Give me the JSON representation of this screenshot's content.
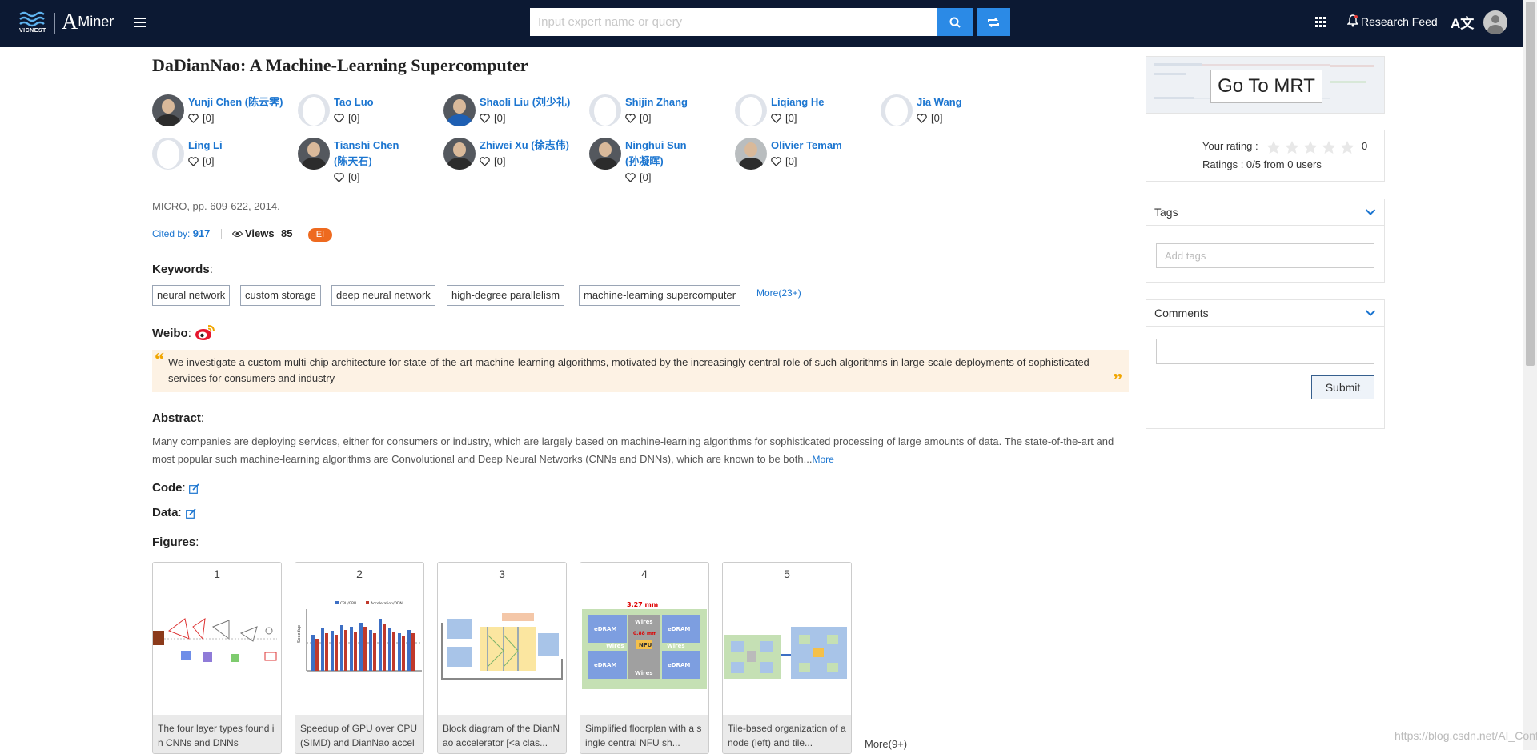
{
  "nav": {
    "logo_text": "VICNEST",
    "brand": "Miner",
    "brand_initial": "A",
    "search_placeholder": "Input expert name or query",
    "research_feed": "Research Feed",
    "translate_label": "A文"
  },
  "paper": {
    "title": "DaDianNao: A Machine-Learning Supercomputer",
    "venue": "MICRO, pp. 609-622, 2014.",
    "cited_label": "Cited by:",
    "cited_count": "917",
    "views_label": "Views",
    "views_count": "85",
    "badge": "EI"
  },
  "authors": [
    {
      "name": "Yunji Chen (陈云霁)",
      "likes": "[0]"
    },
    {
      "name": "Tao Luo",
      "likes": "[0]"
    },
    {
      "name": "Shaoli Liu (刘少礼)",
      "likes": "[0]"
    },
    {
      "name": "Shijin Zhang",
      "likes": "[0]"
    },
    {
      "name": "Liqiang He",
      "likes": "[0]"
    },
    {
      "name": "Jia Wang",
      "likes": "[0]"
    },
    {
      "name": "Ling Li",
      "likes": "[0]"
    },
    {
      "name": "Tianshi Chen (陈天石)",
      "likes": "[0]"
    },
    {
      "name": "Zhiwei Xu (徐志伟)",
      "likes": "[0]"
    },
    {
      "name": "Ninghui Sun (孙凝晖)",
      "likes": "[0]"
    },
    {
      "name": "Olivier Temam",
      "likes": "[0]"
    }
  ],
  "keywords": {
    "label": "Keywords",
    "items": [
      "neural network",
      "custom storage",
      "deep neural network",
      "high-degree parallelism",
      "machine-learning supercomputer"
    ],
    "more": "More(23+)"
  },
  "weibo": {
    "label": "Weibo",
    "quote": "We investigate a custom multi-chip architecture for state-of-the-art machine-learning algorithms, motivated by the increasingly central role of such algorithms in large-scale deployments of sophisticated services for consumers and industry"
  },
  "abstract": {
    "label": "Abstract",
    "text": "Many companies are deploying services, either for consumers or industry, which are largely based on machine-learning algorithms for sophisticated processing of large amounts of data. The state-of-the-art and most popular such machine-learning algorithms are Convolutional and Deep Neural Networks (CNNs and DNNs), which are known to be both...",
    "more": "More"
  },
  "code_label": "Code",
  "data_label": "Data",
  "figures": {
    "label": "Figures",
    "items": [
      {
        "num": "1",
        "caption": "The four layer types found in CNNs and DNNs"
      },
      {
        "num": "2",
        "caption": "Speedup of GPU over CPU (SIMD) and DianNao accel"
      },
      {
        "num": "3",
        "caption": "Block diagram of the DianNao accelerator [<a clas..."
      },
      {
        "num": "4",
        "caption": "Simplified floorplan with a single central NFU sh..."
      },
      {
        "num": "5",
        "caption": "Tile-based organization of a node (left) and tile..."
      }
    ],
    "more": "More(9+)",
    "fig2_legend_a": "CPU/GPU",
    "fig2_legend_b": "Acceleration/DDN",
    "fig2_ylabel": "Speedup",
    "fig4_labels": {
      "top_dim": "3.27 mm",
      "mid_dim": "0.88 mm",
      "edram": "eDRAM",
      "wires": "Wires",
      "nfu": "NFU"
    }
  },
  "sidebar": {
    "mrt_button": "Go To MRT",
    "rating_label": "Your rating :",
    "rating_value": "0",
    "rating_summary": "Ratings : 0/5 from 0 users",
    "tags_title": "Tags",
    "tags_placeholder": "Add tags",
    "comments_title": "Comments",
    "submit": "Submit"
  },
  "watermark": "https://blog.csdn.net/AI_Conf"
}
